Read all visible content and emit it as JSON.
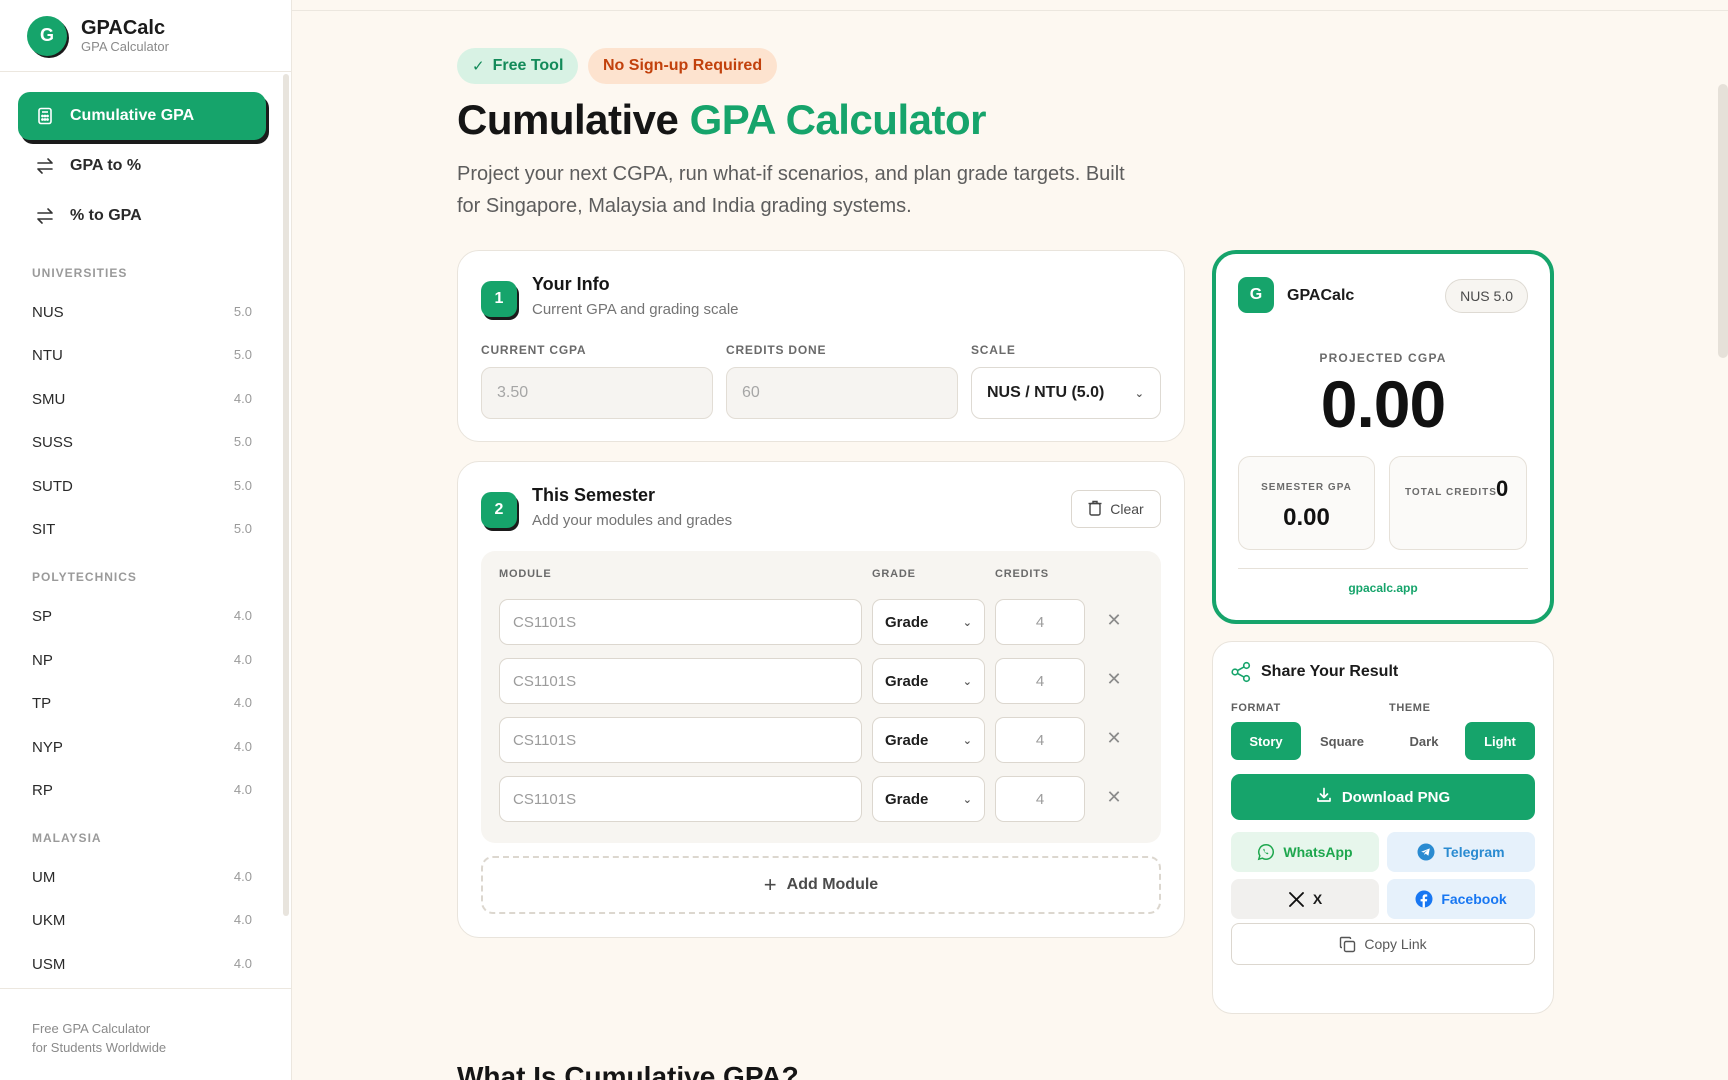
{
  "brand": {
    "logo_letter": "G",
    "name": "GPACalc",
    "subtitle": "GPA Calculator"
  },
  "nav": [
    {
      "label": "Cumulative GPA",
      "icon": "calculator-icon",
      "active": true
    },
    {
      "label": "GPA to %",
      "icon": "swap-arrows-icon",
      "active": false
    },
    {
      "label": "% to GPA",
      "icon": "swap-arrows-icon",
      "active": false
    }
  ],
  "sections": {
    "universities": {
      "label": "UNIVERSITIES",
      "items": [
        {
          "name": "NUS",
          "scale": "5.0"
        },
        {
          "name": "NTU",
          "scale": "5.0"
        },
        {
          "name": "SMU",
          "scale": "4.0"
        },
        {
          "name": "SUSS",
          "scale": "5.0"
        },
        {
          "name": "SUTD",
          "scale": "5.0"
        },
        {
          "name": "SIT",
          "scale": "5.0"
        }
      ]
    },
    "polytechnics": {
      "label": "POLYTECHNICS",
      "items": [
        {
          "name": "SP",
          "scale": "4.0"
        },
        {
          "name": "NP",
          "scale": "4.0"
        },
        {
          "name": "TP",
          "scale": "4.0"
        },
        {
          "name": "NYP",
          "scale": "4.0"
        },
        {
          "name": "RP",
          "scale": "4.0"
        }
      ]
    },
    "malaysia": {
      "label": "MALAYSIA",
      "items": [
        {
          "name": "UM",
          "scale": "4.0"
        },
        {
          "name": "UKM",
          "scale": "4.0"
        },
        {
          "name": "USM",
          "scale": "4.0"
        }
      ]
    }
  },
  "sidebar_footer": {
    "line1": "Free GPA Calculator",
    "line2": "for Students Worldwide"
  },
  "badges": {
    "free": "Free Tool",
    "nosignup": "No Sign-up Required"
  },
  "header": {
    "title_main": "Cumulative ",
    "title_accent": "GPA Calculator",
    "description_line1": "Project your next CGPA, run what-if scenarios, and plan grade targets. Built",
    "description_line2": "for Singapore, Malaysia and India grading systems."
  },
  "your_info": {
    "step": "1",
    "title": "Your Info",
    "subtitle": "Current GPA and grading scale",
    "cgpa_label": "CURRENT CGPA",
    "cgpa_placeholder": "3.50",
    "credits_label": "CREDITS DONE",
    "credits_placeholder": "60",
    "scale_label": "SCALE",
    "scale_value": "NUS / NTU (5.0)"
  },
  "semester": {
    "step": "2",
    "title": "This Semester",
    "subtitle": "Add your modules and grades",
    "clear_label": "Clear",
    "col_module": "MODULE",
    "col_grade": "GRADE",
    "col_credits": "CREDITS",
    "rows": [
      {
        "module_placeholder": "CS1101S",
        "grade": "Grade",
        "credits_placeholder": "4"
      },
      {
        "module_placeholder": "CS1101S",
        "grade": "Grade",
        "credits_placeholder": "4"
      },
      {
        "module_placeholder": "CS1101S",
        "grade": "Grade",
        "credits_placeholder": "4"
      },
      {
        "module_placeholder": "CS1101S",
        "grade": "Grade",
        "credits_placeholder": "4"
      }
    ],
    "add_label": "Add Module"
  },
  "result": {
    "logo_letter": "G",
    "brand": "GPACalc",
    "scale_pill": "NUS 5.0",
    "projected_label": "PROJECTED CGPA",
    "projected_value": "0.00",
    "semester_label": "SEMESTER GPA",
    "semester_value": "0.00",
    "credits_label": "TOTAL CREDITS",
    "credits_value": "0",
    "url": "gpacalc.app"
  },
  "share": {
    "title": "Share Your Result",
    "format_label": "FORMAT",
    "theme_label": "THEME",
    "format_options": [
      "Story",
      "Square"
    ],
    "format_selected": "Story",
    "theme_options": [
      "Dark",
      "Light"
    ],
    "theme_selected": "Light",
    "download_label": "Download PNG",
    "whatsapp": "WhatsApp",
    "telegram": "Telegram",
    "x": "X",
    "facebook": "Facebook",
    "copy": "Copy Link"
  },
  "next_section_title": "What Is Cumulative GPA?",
  "colors": {
    "accent": "#16a46b",
    "background": "#fdf8f1",
    "badge_orange_text": "#c2410c",
    "whatsapp_green": "#1ea74e",
    "telegram_blue": "#2a8bd1",
    "facebook_blue": "#1877f2"
  }
}
